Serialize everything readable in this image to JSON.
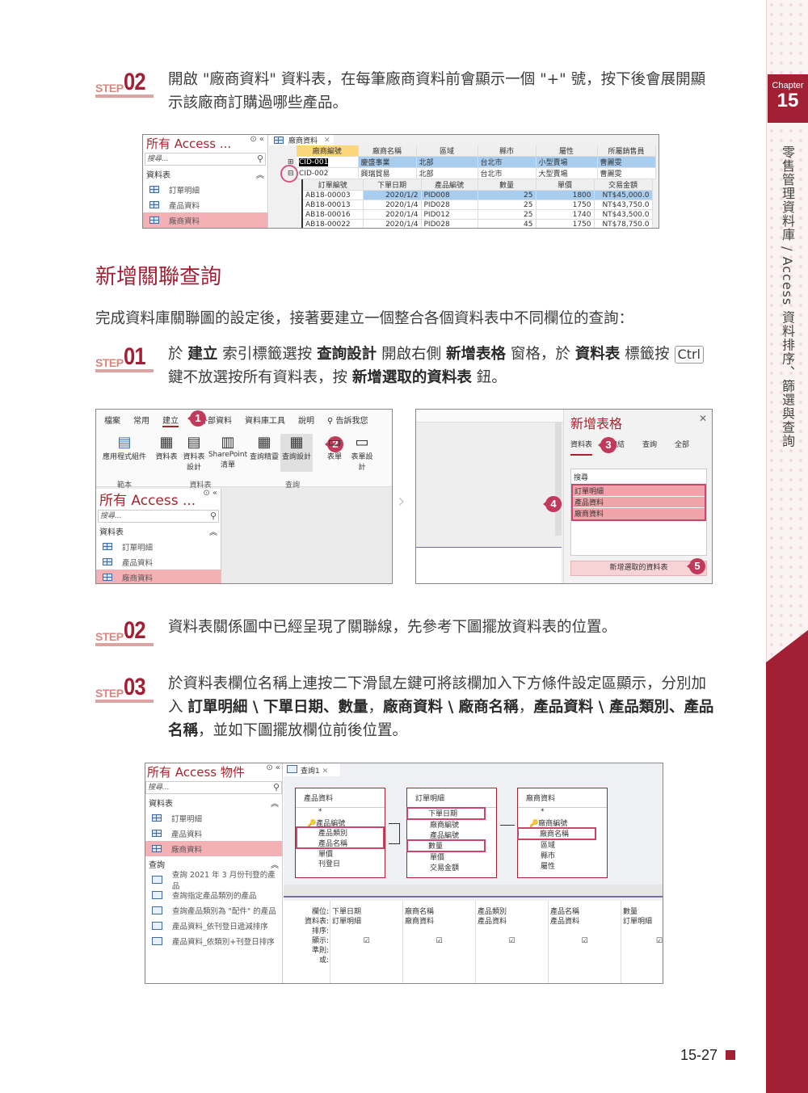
{
  "sidebar": {
    "chapter_label": "Chapter",
    "chapter_number": "15",
    "title": "零售管理資料庫 / Access 資料排序、篩選與查詢"
  },
  "step_top": {
    "step_word": "STEP",
    "step_num": "02",
    "text": "開啟 \"廠商資料\" 資料表，在每筆廠商資料前會顯示一個 \"+\" 號，按下後會展開顯示該廠商訂購過哪些產品。"
  },
  "shot1": {
    "nav_title": "所有 Access ...",
    "search_placeholder": "搜尋...",
    "group": "資料表",
    "items": [
      "訂單明細",
      "產品資料",
      "廠商資料"
    ],
    "tab_label": "廠商資料",
    "main_headers": [
      "廠商編號",
      "廠商名稱",
      "區域",
      "縣市",
      "屬性",
      "所屬銷售員"
    ],
    "main_rows": [
      [
        "CID-001",
        "慶盛事業",
        "北部",
        "台北市",
        "小型賣場",
        "曹麗雯"
      ],
      [
        "CID-002",
        "興瑞貿易",
        "北部",
        "台北市",
        "大型賣場",
        "曹麗雯"
      ]
    ],
    "sub_headers": [
      "訂單編號",
      "下單日期",
      "產品編號",
      "數量",
      "單價",
      "交易金額"
    ],
    "sub_rows": [
      [
        "AB18-00003",
        "2020/1/2",
        "PID008",
        "25",
        "1800",
        "NT$45,000.0"
      ],
      [
        "AB18-00013",
        "2020/1/4",
        "PID028",
        "25",
        "1750",
        "NT$43,750.0"
      ],
      [
        "AB18-00016",
        "2020/1/4",
        "PID012",
        "25",
        "1740",
        "NT$43,500.0"
      ],
      [
        "AB18-00022",
        "2020/1/4",
        "PID028",
        "45",
        "1750",
        "NT$78,750.0"
      ]
    ]
  },
  "section": {
    "title": "新增關聯查詢",
    "intro": "完成資料庫關聯圖的設定後，接著要建立一個整合各個資料表中不同欄位的查詢："
  },
  "step1": {
    "step_word": "STEP",
    "step_num": "01",
    "t1": "於 ",
    "b1": "建立",
    "t2": " 索引標籤選按 ",
    "b2": "查詢設計",
    "t3": " 開啟右側 ",
    "b3": "新增表格",
    "t4": " 窗格，於 ",
    "b4": "資料表",
    "t5": " 標籤按 ",
    "kbd": "Ctrl",
    "t6": " 鍵不放選按所有資料表，按 ",
    "b5": "新增選取的資料表",
    "t7": " 鈕。"
  },
  "shot2": {
    "ribbon_tabs": [
      "檔案",
      "常用",
      "建立",
      "外部資料",
      "資料庫工具",
      "說明"
    ],
    "tell_me": "告訴我您",
    "buttons": [
      "應用程式組件",
      "資料表",
      "資料表設計",
      "SharePoint 清單",
      "查詢精靈",
      "查詢設計",
      "表單",
      "表單設計"
    ],
    "groups": [
      "範本",
      "資料表",
      "查詢"
    ],
    "nav_title": "所有 Access ...",
    "search_placeholder": "搜尋...",
    "group": "資料表",
    "items": [
      "訂單明細",
      "產品資料",
      "廠商資料"
    ],
    "badges": [
      "1",
      "2"
    ]
  },
  "shot3": {
    "pane_title": "新增表格",
    "tabs": [
      "資料表",
      "連結",
      "查詢",
      "全部"
    ],
    "search_placeholder": "搜尋",
    "items": [
      "訂單明細",
      "產品資料",
      "廠商資料"
    ],
    "add_button": "新增選取的資料表",
    "badges": [
      "3",
      "4",
      "5"
    ]
  },
  "step2": {
    "step_word": "STEP",
    "step_num": "02",
    "text": "資料表關係圖中已經呈現了關聯線，先參考下圖擺放資料表的位置。"
  },
  "step3": {
    "step_word": "STEP",
    "step_num": "03",
    "t1": "於資料表欄位名稱上連按二下滑鼠左鍵可將該欄加入下方條件設定區顯示，分別加入 ",
    "b1": "訂單明細 \\ 下單日期、數量",
    "t2": "，",
    "b2": "廠商資料 \\ 廠商名稱",
    "t3": "，",
    "b3": "產品資料 \\ 產品類別、產品名稱",
    "t4": "，並如下圖擺放欄位前後位置。"
  },
  "shot4": {
    "nav_title": "所有 Access 物件",
    "search_placeholder": "搜尋...",
    "group_tables": "資料表",
    "tables": [
      "訂單明細",
      "產品資料",
      "廠商資料"
    ],
    "group_queries": "查詢",
    "queries": [
      "查詢 2021 年 3 月份刊登的產品",
      "查詢指定產品類別的產品",
      "查詢產品類別為 \"配件\" 的產品",
      "產品資料_依刊登日遞減排序",
      "產品資料_依類別+刊登日排序"
    ],
    "tab_label": "查詢1",
    "boxes": [
      {
        "title": "產品資料",
        "fields": [
          "*",
          "產品編號",
          "產品類別",
          "產品名稱",
          "單價",
          "刊登日"
        ]
      },
      {
        "title": "訂單明細",
        "fields": [
          "下單日期",
          "廠商編號",
          "產品編號",
          "數量",
          "單價",
          "交易金額"
        ]
      },
      {
        "title": "廠商資料",
        "fields": [
          "*",
          "廠商編號",
          "廠商名稱",
          "區域",
          "縣市",
          "屬性"
        ]
      }
    ],
    "row_labels": [
      "欄位:",
      "資料表:",
      "排序:",
      "顯示:",
      "準則:",
      "或:"
    ],
    "columns": [
      {
        "field": "下單日期",
        "table": "訂單明細"
      },
      {
        "field": "廠商名稱",
        "table": "廠商資料"
      },
      {
        "field": "產品類別",
        "table": "產品資料"
      },
      {
        "field": "產品名稱",
        "table": "產品資料"
      },
      {
        "field": "數量",
        "table": "訂單明細"
      }
    ]
  },
  "footer": {
    "page": "15-27"
  }
}
